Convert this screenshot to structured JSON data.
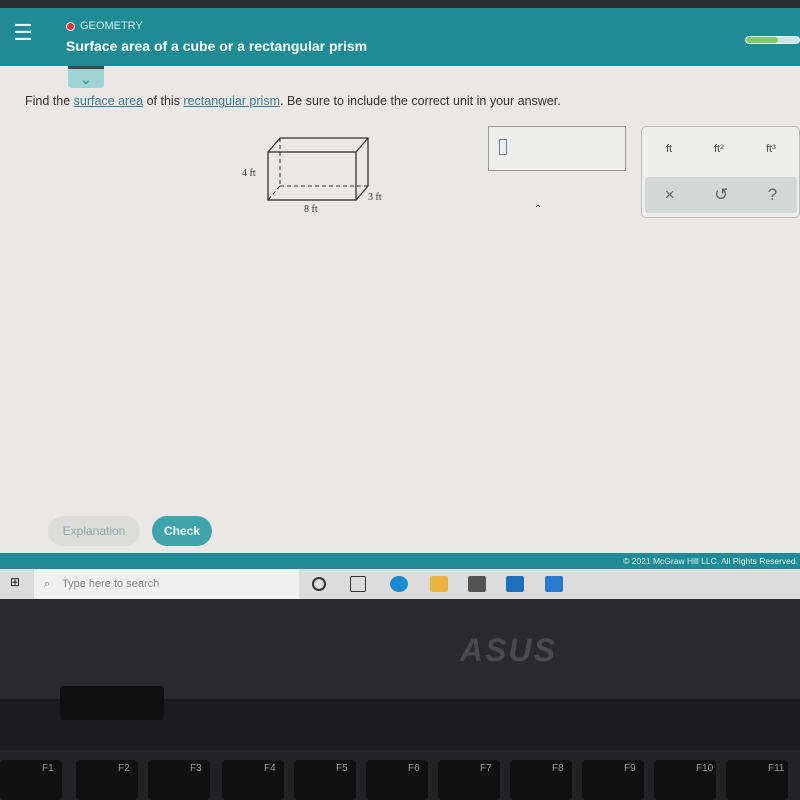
{
  "header": {
    "topic": "GEOMETRY",
    "title": "Surface area of a cube or a rectangular prism",
    "menu_icon": "hamburger-icon",
    "progress": 0.6
  },
  "question": {
    "prefix": "Find the ",
    "link1": "surface area",
    "middle": " of this ",
    "link2": "rectangular prism",
    "suffix": ". Be sure to include the correct unit in your answer."
  },
  "figure": {
    "height": "4 ft",
    "depth": "3 ft",
    "length": "8 ft"
  },
  "answer": {
    "value": ""
  },
  "keypad": {
    "units": [
      "ft",
      "ft²",
      "ft³"
    ],
    "clear": "×",
    "undo": "↺",
    "help": "?"
  },
  "buttons": {
    "explanation": "Explanation",
    "check": "Check"
  },
  "footer": {
    "copyright": "© 2021 McGraw Hill LLC. All Rights Reserved."
  },
  "taskbar": {
    "search_placeholder": "Type here to search"
  },
  "laptop": {
    "brand": "ASUS",
    "fkeys": [
      "F1",
      "F2",
      "F3",
      "F4",
      "F5",
      "F6",
      "F7",
      "F8",
      "F9",
      "F10",
      "F11"
    ]
  },
  "colors": {
    "teal": "#1f8b95",
    "check": "#3fa4ab"
  }
}
